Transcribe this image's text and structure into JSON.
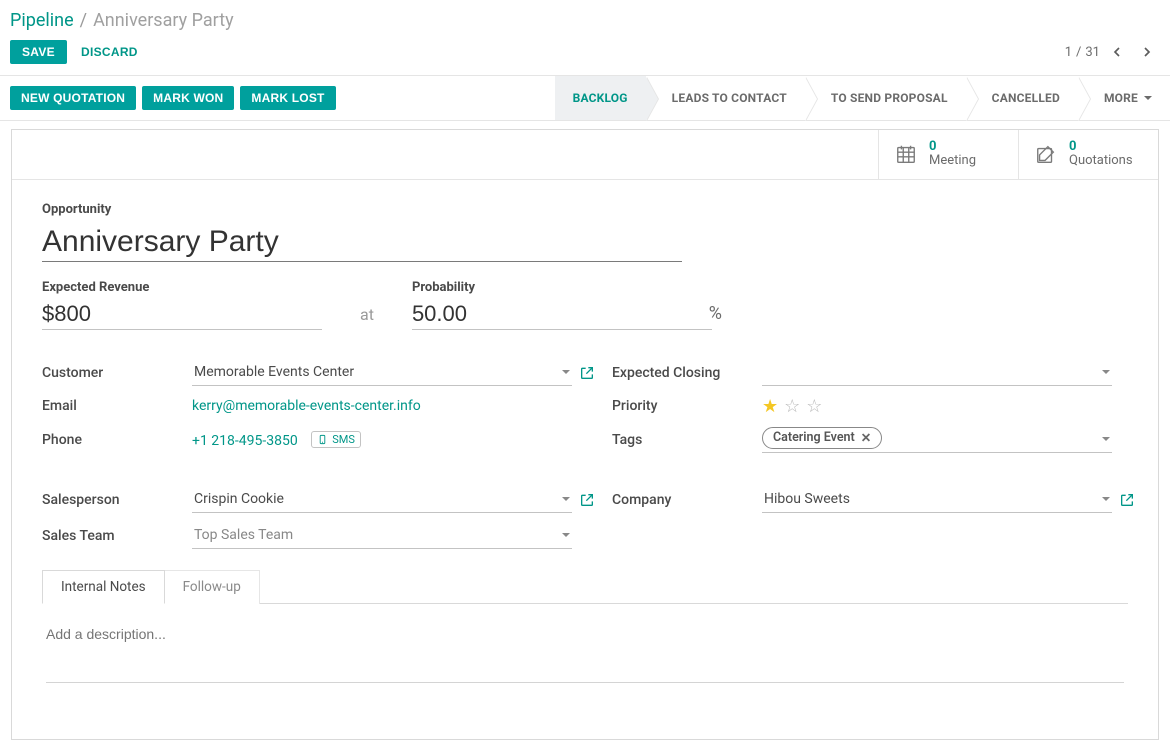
{
  "breadcrumb": {
    "root": "Pipeline",
    "sep": "/",
    "current": "Anniversary Party"
  },
  "controls": {
    "save": "SAVE",
    "discard": "DISCARD",
    "pager": {
      "position": "1",
      "sep": "/",
      "total": "31"
    }
  },
  "actions": {
    "new_quotation": "NEW QUOTATION",
    "mark_won": "MARK WON",
    "mark_lost": "MARK LOST"
  },
  "stages": {
    "items": [
      {
        "label": "BACKLOG",
        "active": true
      },
      {
        "label": "LEADS TO CONTACT",
        "active": false
      },
      {
        "label": "TO SEND PROPOSAL",
        "active": false
      },
      {
        "label": "CANCELLED",
        "active": false
      }
    ],
    "more": "MORE"
  },
  "stats": {
    "meeting": {
      "count": "0",
      "label": "Meeting"
    },
    "quotations": {
      "count": "0",
      "label": "Quotations"
    }
  },
  "form": {
    "opportunity_label": "Opportunity",
    "name": "Anniversary Party",
    "expected_revenue_label": "Expected Revenue",
    "expected_revenue": "$800",
    "at": "at",
    "probability_label": "Probability",
    "probability": "50.00",
    "pct": "%",
    "labels": {
      "customer": "Customer",
      "email": "Email",
      "phone": "Phone",
      "salesperson": "Salesperson",
      "sales_team": "Sales Team",
      "expected_closing": "Expected Closing",
      "priority": "Priority",
      "tags": "Tags",
      "company": "Company"
    },
    "customer": "Memorable Events Center",
    "email": "kerry@memorable-events-center.info",
    "phone": "+1 218-495-3850",
    "sms": "SMS",
    "salesperson": "Crispin Cookie",
    "sales_team": "Top Sales Team",
    "expected_closing": "",
    "priority_stars": 1,
    "tags": [
      "Catering Event"
    ],
    "company": "Hibou Sweets"
  },
  "tabs": {
    "items": [
      "Internal Notes",
      "Follow-up"
    ],
    "active": 0,
    "description_placeholder": "Add a description..."
  }
}
